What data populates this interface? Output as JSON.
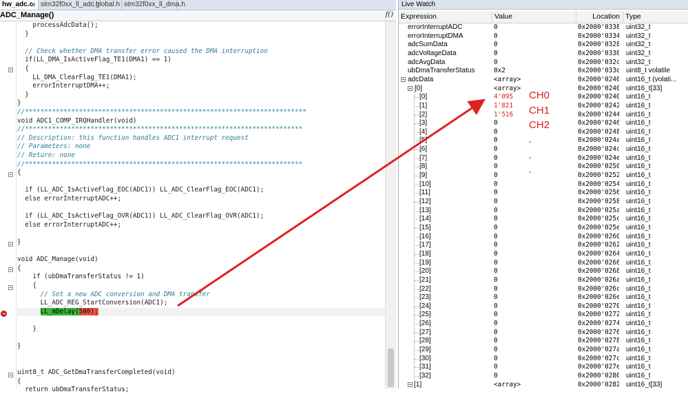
{
  "editor": {
    "tabs": [
      "hw_adc.c",
      "stm32f0xx_ll_adc.h",
      "global.h",
      "stm32f0xx_ll_dma.h"
    ],
    "function_name": "ADC_Manage()",
    "function_button": "f()",
    "lines": [
      "    processAdcData();",
      "  }",
      "",
      "  // Check whether DMA transfer error caused the DMA interruption",
      "  if(LL_DMA_IsActiveFlag_TE1(DMA1) == 1)",
      "  {",
      "    LL_DMA_ClearFlag_TE1(DMA1);",
      "    errorInterruptDMA++;",
      "  }",
      "}",
      "//*************************************************************************",
      "void ADC1_COMP_IRQHandler(void)",
      "//************************************************************************",
      "// Description: this function handles ADC1 interrupt request",
      "// Parameters: none",
      "// Return: none",
      "//************************************************************************",
      "{",
      "",
      "  if (LL_ADC_IsActiveFlag_EOC(ADC1)) LL_ADC_ClearFlag_EOC(ADC1);",
      "  else errorInterruptADC++;",
      "",
      "  if (LL_ADC_IsActiveFlag_OVR(ADC1)) LL_ADC_ClearFlag_OVR(ADC1);",
      "  else errorInterruptADC++;",
      "",
      "}",
      "",
      "void ADC_Manage(void)",
      "{",
      "    if (ubDmaTransferStatus != 1)",
      "    {",
      "      // Set a new ADC conversion and DMA transfer",
      "      LL_ADC_REG_StartConversion(ADC1);",
      "      LL_mDelay(500);",
      "",
      "    }",
      "",
      "}",
      "",
      "",
      "uint8_t ADC_GetDmaTransferCompleted(void)",
      "{",
      "  return ubDmaTransferStatus;"
    ],
    "delay_call": "LL_mDelay(",
    "delay_arg": "500",
    "delay_tail": ");"
  },
  "watch": {
    "title": "Live Watch",
    "columns": [
      "Expression",
      "Value",
      "Location",
      "Type"
    ],
    "rows": [
      {
        "expr": "errorInterruptADC",
        "value": "0",
        "loc": "0x2000'0338",
        "type": "uint32_t"
      },
      {
        "expr": "errorInterruptDMA",
        "value": "0",
        "loc": "0x2000'0334",
        "type": "uint32_t"
      },
      {
        "expr": "adcSumData",
        "value": "0",
        "loc": "0x2000'0328",
        "type": "uint32_t"
      },
      {
        "expr": "adcVoltageData",
        "value": "0",
        "loc": "0x2000'0330",
        "type": "uint32_t"
      },
      {
        "expr": "adcAvgData",
        "value": "0",
        "loc": "0x2000'032c",
        "type": "uint32_t"
      },
      {
        "expr": "ubDmaTransferStatus",
        "value": "0x2",
        "loc": "0x2000'033d",
        "type": "uint8_t volatile"
      },
      {
        "expr": "adcData",
        "value": "<array>",
        "loc": "0x2000'0240",
        "type": "uint16_t (volati..."
      },
      {
        "expr": "[0]",
        "value": "<array>",
        "loc": "0x2000'0240",
        "type": "uint16_t[33]"
      },
      {
        "expr": "[0]",
        "value": "4'095",
        "loc": "0x2000'0240",
        "type": "uint16_t"
      },
      {
        "expr": "[1]",
        "value": "1'821",
        "loc": "0x2000'0242",
        "type": "uint16_t"
      },
      {
        "expr": "[2]",
        "value": "1'516",
        "loc": "0x2000'0244",
        "type": "uint16_t"
      },
      {
        "expr": "[3]",
        "value": "0",
        "loc": "0x2000'0246",
        "type": "uint16_t"
      },
      {
        "expr": "[4]",
        "value": "0",
        "loc": "0x2000'0248",
        "type": "uint16_t"
      },
      {
        "expr": "[5]",
        "value": "0",
        "loc": "0x2000'024a",
        "type": "uint16_t"
      },
      {
        "expr": "[6]",
        "value": "0",
        "loc": "0x2000'024c",
        "type": "uint16_t"
      },
      {
        "expr": "[7]",
        "value": "0",
        "loc": "0x2000'024e",
        "type": "uint16_t"
      },
      {
        "expr": "[8]",
        "value": "0",
        "loc": "0x2000'0250",
        "type": "uint16_t"
      },
      {
        "expr": "[9]",
        "value": "0",
        "loc": "0x2000'0252",
        "type": "uint16_t"
      },
      {
        "expr": "[10]",
        "value": "0",
        "loc": "0x2000'0254",
        "type": "uint16_t"
      },
      {
        "expr": "[11]",
        "value": "0",
        "loc": "0x2000'0256",
        "type": "uint16_t"
      },
      {
        "expr": "[12]",
        "value": "0",
        "loc": "0x2000'0258",
        "type": "uint16_t"
      },
      {
        "expr": "[13]",
        "value": "0",
        "loc": "0x2000'025a",
        "type": "uint16_t"
      },
      {
        "expr": "[14]",
        "value": "0",
        "loc": "0x2000'025c",
        "type": "uint16_t"
      },
      {
        "expr": "[15]",
        "value": "0",
        "loc": "0x2000'025e",
        "type": "uint16_t"
      },
      {
        "expr": "[16]",
        "value": "0",
        "loc": "0x2000'0260",
        "type": "uint16_t"
      },
      {
        "expr": "[17]",
        "value": "0",
        "loc": "0x2000'0262",
        "type": "uint16_t"
      },
      {
        "expr": "[18]",
        "value": "0",
        "loc": "0x2000'0264",
        "type": "uint16_t"
      },
      {
        "expr": "[19]",
        "value": "0",
        "loc": "0x2000'0266",
        "type": "uint16_t"
      },
      {
        "expr": "[20]",
        "value": "0",
        "loc": "0x2000'0268",
        "type": "uint16_t"
      },
      {
        "expr": "[21]",
        "value": "0",
        "loc": "0x2000'026a",
        "type": "uint16_t"
      },
      {
        "expr": "[22]",
        "value": "0",
        "loc": "0x2000'026c",
        "type": "uint16_t"
      },
      {
        "expr": "[23]",
        "value": "0",
        "loc": "0x2000'026e",
        "type": "uint16_t"
      },
      {
        "expr": "[24]",
        "value": "0",
        "loc": "0x2000'0270",
        "type": "uint16_t"
      },
      {
        "expr": "[25]",
        "value": "0",
        "loc": "0x2000'0272",
        "type": "uint16_t"
      },
      {
        "expr": "[26]",
        "value": "0",
        "loc": "0x2000'0274",
        "type": "uint16_t"
      },
      {
        "expr": "[27]",
        "value": "0",
        "loc": "0x2000'0276",
        "type": "uint16_t"
      },
      {
        "expr": "[28]",
        "value": "0",
        "loc": "0x2000'0278",
        "type": "uint16_t"
      },
      {
        "expr": "[29]",
        "value": "0",
        "loc": "0x2000'027a",
        "type": "uint16_t"
      },
      {
        "expr": "[30]",
        "value": "0",
        "loc": "0x2000'027c",
        "type": "uint16_t"
      },
      {
        "expr": "[31]",
        "value": "0",
        "loc": "0x2000'027e",
        "type": "uint16_t"
      },
      {
        "expr": "[32]",
        "value": "0",
        "loc": "0x2000'0280",
        "type": "uint16_t"
      },
      {
        "expr": "[1]",
        "value": "<array>",
        "loc": "0x2000'0282",
        "type": "uint16_t[33]"
      }
    ]
  },
  "annotations": {
    "labels": [
      "CH0",
      "CH1",
      "CH2"
    ],
    "dots": [
      ".",
      ".",
      "."
    ],
    "color": "#e02020"
  }
}
